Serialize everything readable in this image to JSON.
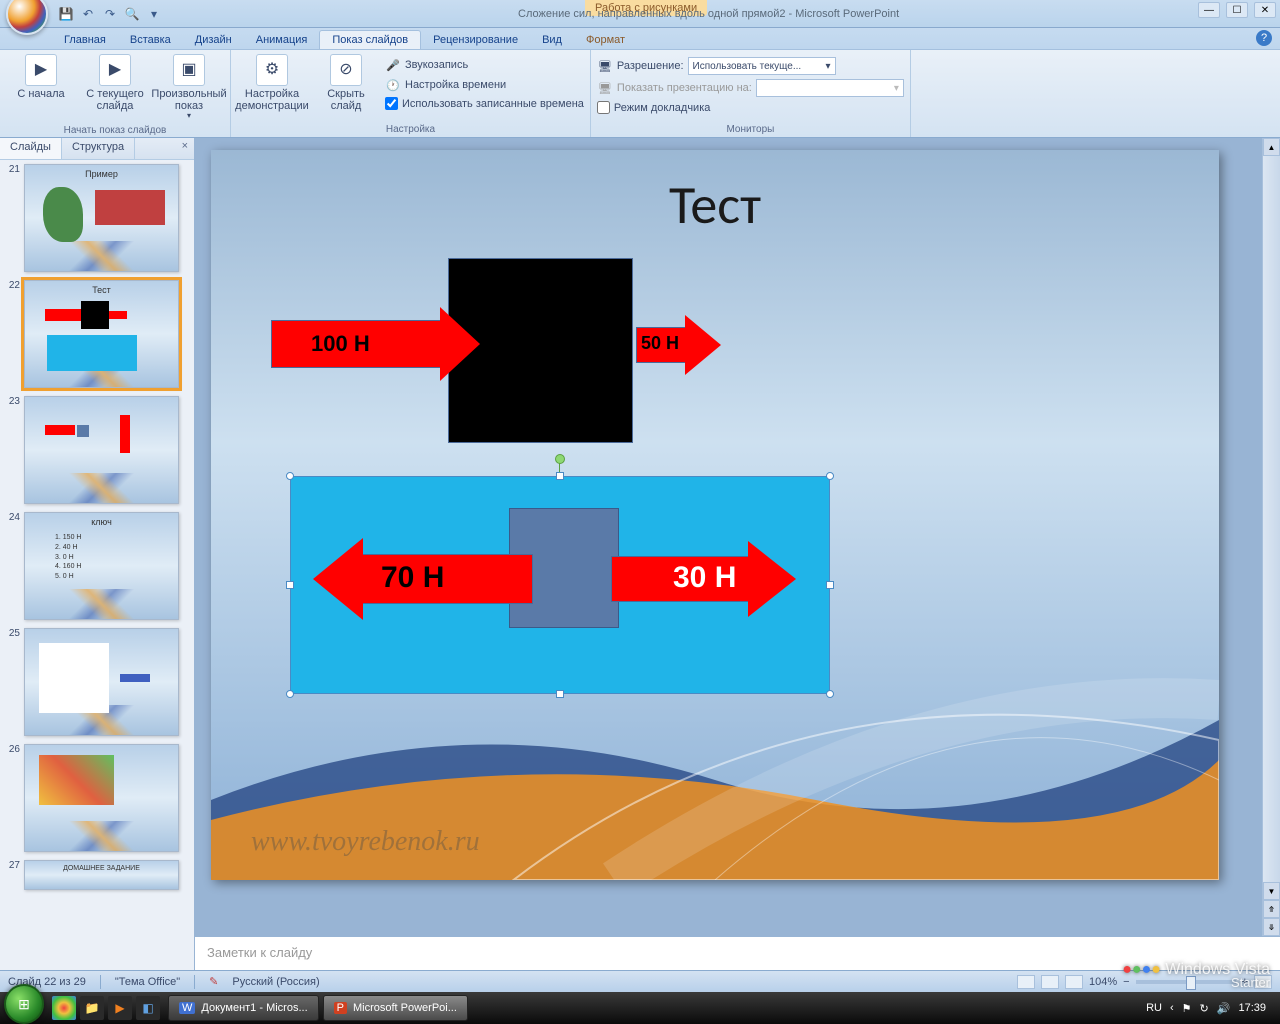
{
  "title_tools": "Работа с рисунками",
  "doc_title": "Сложение сил, направленных вдоль одной прямой2 - Microsoft PowerPoint",
  "tabs": {
    "home": "Главная",
    "insert": "Вставка",
    "design": "Дизайн",
    "anim": "Анимация",
    "slideshow": "Показ слайдов",
    "review": "Рецензирование",
    "view": "Вид",
    "format": "Формат"
  },
  "ribbon": {
    "g1": {
      "label": "Начать показ слайдов",
      "from_start": "С начала",
      "from_current": "С текущего слайда",
      "custom": "Произвольный показ"
    },
    "g2": {
      "label": "Настройка",
      "setup": "Настройка демонстрации",
      "hide": "Скрыть слайд",
      "rec": "Звукозапись",
      "rehearse": "Настройка времени",
      "use_timings": "Использовать записанные времена"
    },
    "g3": {
      "label": "Мониторы",
      "res": "Разрешение:",
      "show_on": "Показать презентацию на:",
      "presenter": "Режим докладчика",
      "res_val": "Использовать текуще..."
    }
  },
  "side": {
    "slides": "Слайды",
    "outline": "Структура"
  },
  "thumbs": [
    {
      "n": "21",
      "title": "Пример"
    },
    {
      "n": "22",
      "title": "Тест"
    },
    {
      "n": "23",
      "title": ""
    },
    {
      "n": "24",
      "title": "ключ"
    },
    {
      "n": "25",
      "title": ""
    },
    {
      "n": "26",
      "title": ""
    },
    {
      "n": "27",
      "title": "ДОМАШНЕЕ ЗАДАНИЕ"
    }
  ],
  "thumb24_lines": [
    "1. 150 Н",
    "2. 40 Н",
    "3. 0 Н",
    "4. 160 Н",
    "5. 0 Н"
  ],
  "slide": {
    "title": "Тест",
    "arr1": "100 Н",
    "arr2": "50 Н",
    "arr3": "70 Н",
    "arr4": "30 Н",
    "watermark": "www.tvoyrebenok.ru"
  },
  "notes_placeholder": "Заметки к слайду",
  "status": {
    "slide": "Слайд 22 из 29",
    "theme": "\"Тема Office\"",
    "lang": "Русский (Россия)",
    "zoom": "104%"
  },
  "taskbar": {
    "doc1": "Документ1 - Micros...",
    "ppt": "Microsoft PowerPoi...",
    "lang": "RU",
    "time": "17:39"
  },
  "vista": {
    "l1": "Windows Vista",
    "l2": "Starter"
  }
}
